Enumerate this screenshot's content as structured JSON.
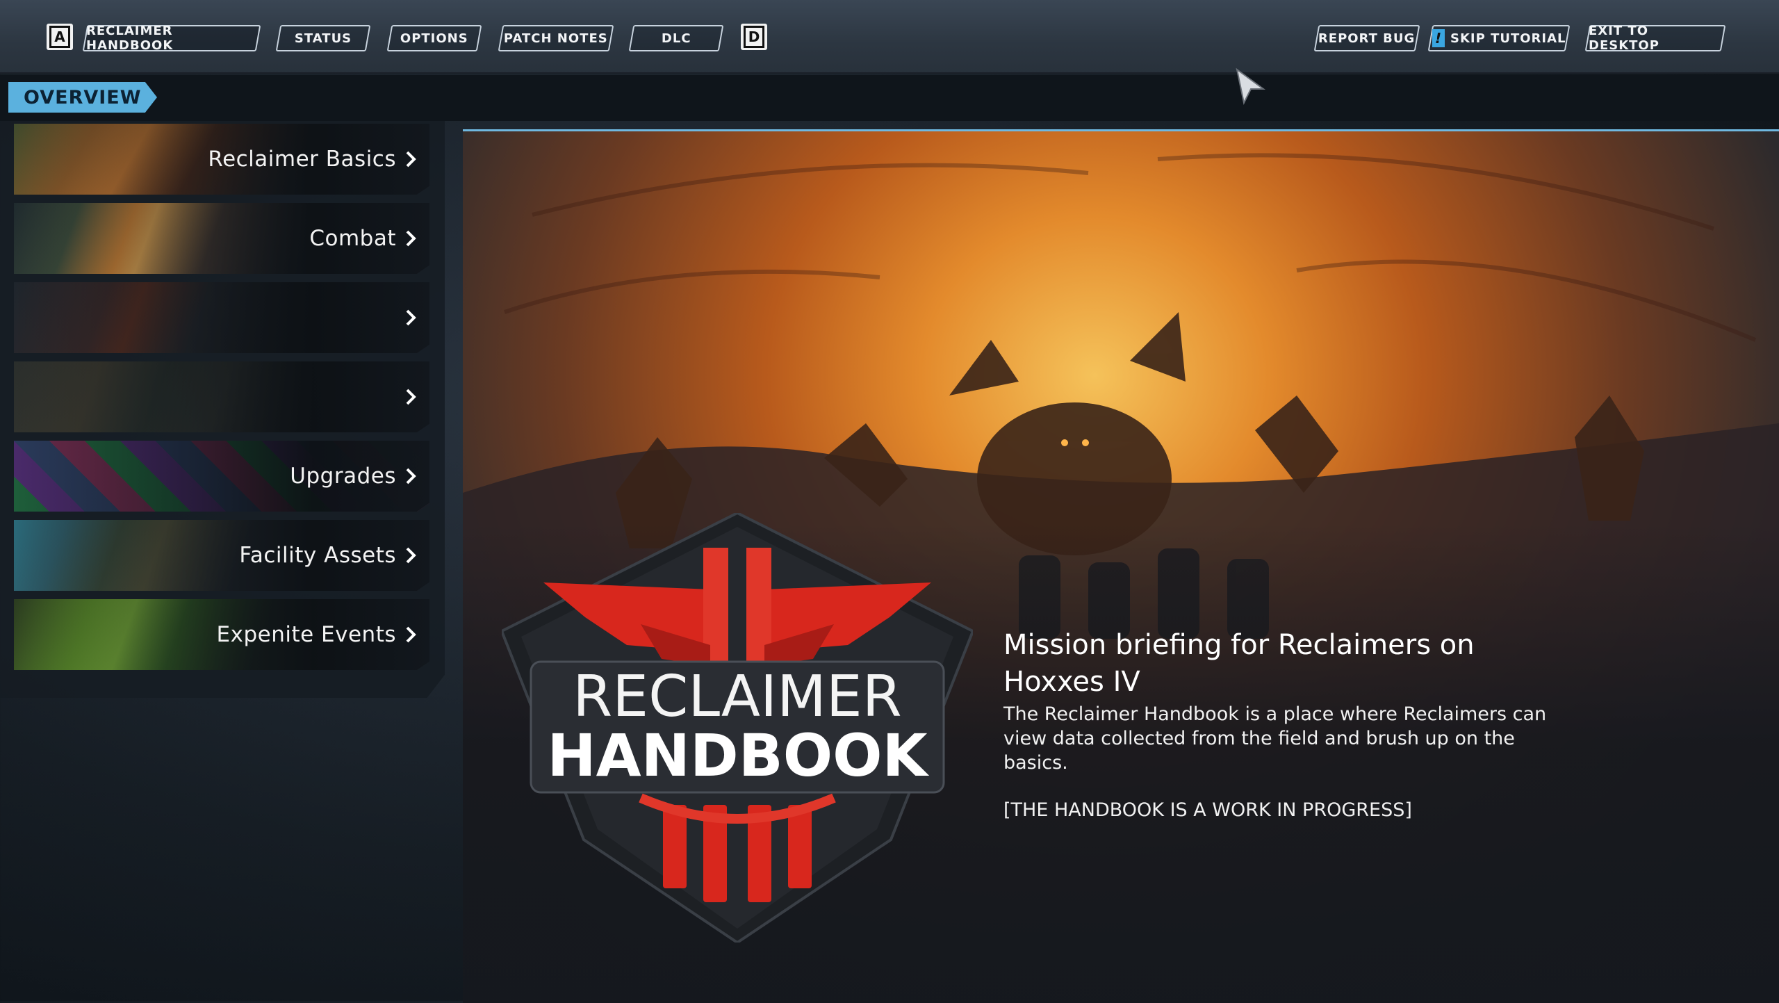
{
  "topbar": {
    "left_key": "A",
    "right_key": "D",
    "tabs": [
      {
        "label": "RECLAIMER HANDBOOK"
      },
      {
        "label": "STATUS"
      },
      {
        "label": "OPTIONS"
      },
      {
        "label": "PATCH NOTES"
      },
      {
        "label": "DLC"
      }
    ],
    "actions": {
      "report_bug": "REPORT BUG",
      "skip_tutorial": "SKIP TUTORIAL",
      "skip_tutorial_icon": "!",
      "exit_to_desktop": "EXIT TO DESKTOP"
    }
  },
  "section": {
    "label": "OVERVIEW"
  },
  "menu": {
    "items": [
      {
        "label": "Reclaimer Basics",
        "icon": "chevron-right"
      },
      {
        "label": "Combat",
        "icon": "chevron-right"
      },
      {
        "label": "",
        "icon": "chevron-right"
      },
      {
        "label": "",
        "icon": "chevron-right"
      },
      {
        "label": "Upgrades",
        "icon": "chevron-right"
      },
      {
        "label": "Facility Assets",
        "icon": "chevron-right"
      },
      {
        "label": "Expenite Events",
        "icon": "chevron-right"
      }
    ]
  },
  "emblem": {
    "line1": "RECLAIMER",
    "line2": "HANDBOOK"
  },
  "briefing": {
    "title": "Mission briefing for Reclaimers on Hoxxes IV",
    "body": "The Reclaimer Handbook is a place where Reclaimers can view data collected from the field and brush up on the basics.",
    "note": "[THE HANDBOOK IS A WORK IN PROGRESS]"
  },
  "colors": {
    "accent": "#5bb1de",
    "emblem_red": "#d8271d",
    "emblem_dark": "#1d2024"
  }
}
